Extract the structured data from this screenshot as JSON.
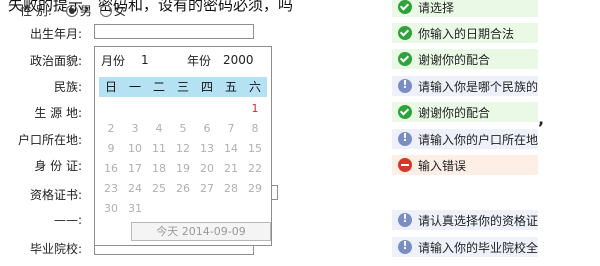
{
  "top": {
    "cut_text": "失败的提示，密码和，设有的密码必须，吗",
    "gender_label": "性    别:",
    "gender_male": "男",
    "gender_female": "女"
  },
  "labels": {
    "birth": "出生年月:",
    "politics": "政治面貌:",
    "ethnicity": "民族:",
    "origin": "生 源 地:",
    "hukou": "户口所在地:",
    "idcard": "身 份 证:",
    "cert": "资格证书:",
    "dash": "——:",
    "school": "毕业院校:"
  },
  "messages": [
    {
      "type": "ok",
      "text": "请选择",
      "bg": "green"
    },
    {
      "type": "ok",
      "text": "你输入的日期合法",
      "bg": "green"
    },
    {
      "type": "ok",
      "text": "谢谢你的配合",
      "bg": "green"
    },
    {
      "type": "info",
      "text": "请输入你是哪个民族的",
      "bg": "blue"
    },
    {
      "type": "ok",
      "text": "谢谢你的配合",
      "bg": "green"
    },
    {
      "type": "info",
      "text": "请输入你的户口所在地",
      "bg": "blue"
    },
    {
      "type": "err",
      "text": "输入错误",
      "bg": "red"
    },
    {
      "type": "info",
      "text": "请认真选择你的资格证",
      "bg": "blue"
    },
    {
      "type": "info",
      "text": "请输入你的毕业院校全",
      "bg": "blue"
    }
  ],
  "stray_comma": "’",
  "calendar": {
    "month_label": "月份",
    "month_value": "1",
    "year_label": "年份",
    "year_value": "2000",
    "weekdays": [
      "日",
      "一",
      "二",
      "三",
      "四",
      "五",
      "六"
    ],
    "rows": [
      [
        "",
        "",
        "",
        "",
        "",
        "",
        "1"
      ],
      [
        "2",
        "3",
        "4",
        "5",
        "6",
        "7",
        "8"
      ],
      [
        "9",
        "10",
        "11",
        "12",
        "13",
        "14",
        "15"
      ],
      [
        "16",
        "17",
        "18",
        "19",
        "20",
        "21",
        "22"
      ],
      [
        "23",
        "24",
        "25",
        "26",
        "27",
        "28",
        "29"
      ],
      [
        "30",
        "31",
        "",
        "",
        "",
        "",
        ""
      ]
    ],
    "today_button": "今天 2014-09-09"
  },
  "colors": {
    "ok": "#2ea23b",
    "info": "#7a8ec4",
    "err": "#d7372a",
    "calendar_header": "#b4e2f2",
    "red_day": "#d82a2a"
  }
}
